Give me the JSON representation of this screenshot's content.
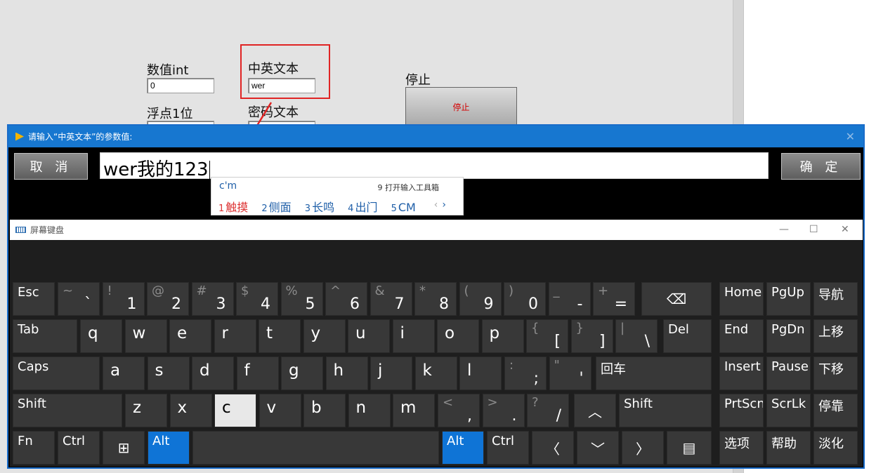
{
  "panel": {
    "int_label": "数值int",
    "int_value": "0",
    "text_label": "中英文本",
    "text_value": "wer",
    "float_label": "浮点1位",
    "password_label": "密码文本",
    "stop_label": "停止",
    "stop_button": "停止"
  },
  "dialog": {
    "title": "请输入“中英文本”的参数值:",
    "cancel": "取 消",
    "ok": "确 定",
    "input_value": "wer我的123"
  },
  "ime": {
    "composition": "c'm",
    "tool": "9 打开输入工具箱",
    "candidates": [
      {
        "n": "1",
        "text": "触摸"
      },
      {
        "n": "2",
        "text": "侧面"
      },
      {
        "n": "3",
        "text": "长鸣"
      },
      {
        "n": "4",
        "text": "出门"
      },
      {
        "n": "5",
        "text": "CM"
      }
    ]
  },
  "osk": {
    "title": "屏幕键盘",
    "keys": {
      "esc": "Esc",
      "tab": "Tab",
      "caps": "Caps",
      "shift": "Shift",
      "fn": "Fn",
      "ctrl": "Ctrl",
      "alt": "Alt",
      "del": "Del",
      "enter": "回车",
      "home": "Home",
      "pgup": "PgUp",
      "nav": "导航",
      "end": "End",
      "pgdn": "PgDn",
      "up": "上移",
      "insert": "Insert",
      "pause": "Pause",
      "down": "下移",
      "prtscn": "PrtScn",
      "scrlk": "ScrLk",
      "dock": "停靠",
      "options": "选项",
      "help": "帮助",
      "fade": "淡化"
    },
    "number_row": [
      {
        "top": "~",
        "bot": "`"
      },
      {
        "top": "!",
        "bot": "1"
      },
      {
        "top": "@",
        "bot": "2"
      },
      {
        "top": "#",
        "bot": "3"
      },
      {
        "top": "$",
        "bot": "4"
      },
      {
        "top": "%",
        "bot": "5"
      },
      {
        "top": "^",
        "bot": "6"
      },
      {
        "top": "&",
        "bot": "7"
      },
      {
        "top": "*",
        "bot": "8"
      },
      {
        "top": "(",
        "bot": "9"
      },
      {
        "top": ")",
        "bot": "0"
      },
      {
        "top": "_",
        "bot": "-"
      },
      {
        "top": "+",
        "bot": "="
      }
    ],
    "row_q": [
      "q",
      "w",
      "e",
      "r",
      "t",
      "y",
      "u",
      "i",
      "o",
      "p"
    ],
    "row_q_extra": [
      {
        "top": "{",
        "bot": "["
      },
      {
        "top": "}",
        "bot": "]"
      },
      {
        "top": "|",
        "bot": "\\"
      }
    ],
    "row_a": [
      "a",
      "s",
      "d",
      "f",
      "g",
      "h",
      "j",
      "k",
      "l"
    ],
    "row_a_extra": [
      {
        "top": ":",
        "bot": ";"
      },
      {
        "top": "\"",
        "bot": "'"
      }
    ],
    "row_z": [
      "z",
      "x",
      "c",
      "v",
      "b",
      "n",
      "m"
    ],
    "row_z_extra": [
      {
        "top": "<",
        "bot": ","
      },
      {
        "top": ">",
        "bot": "."
      },
      {
        "top": "?",
        "bot": "/"
      }
    ]
  }
}
